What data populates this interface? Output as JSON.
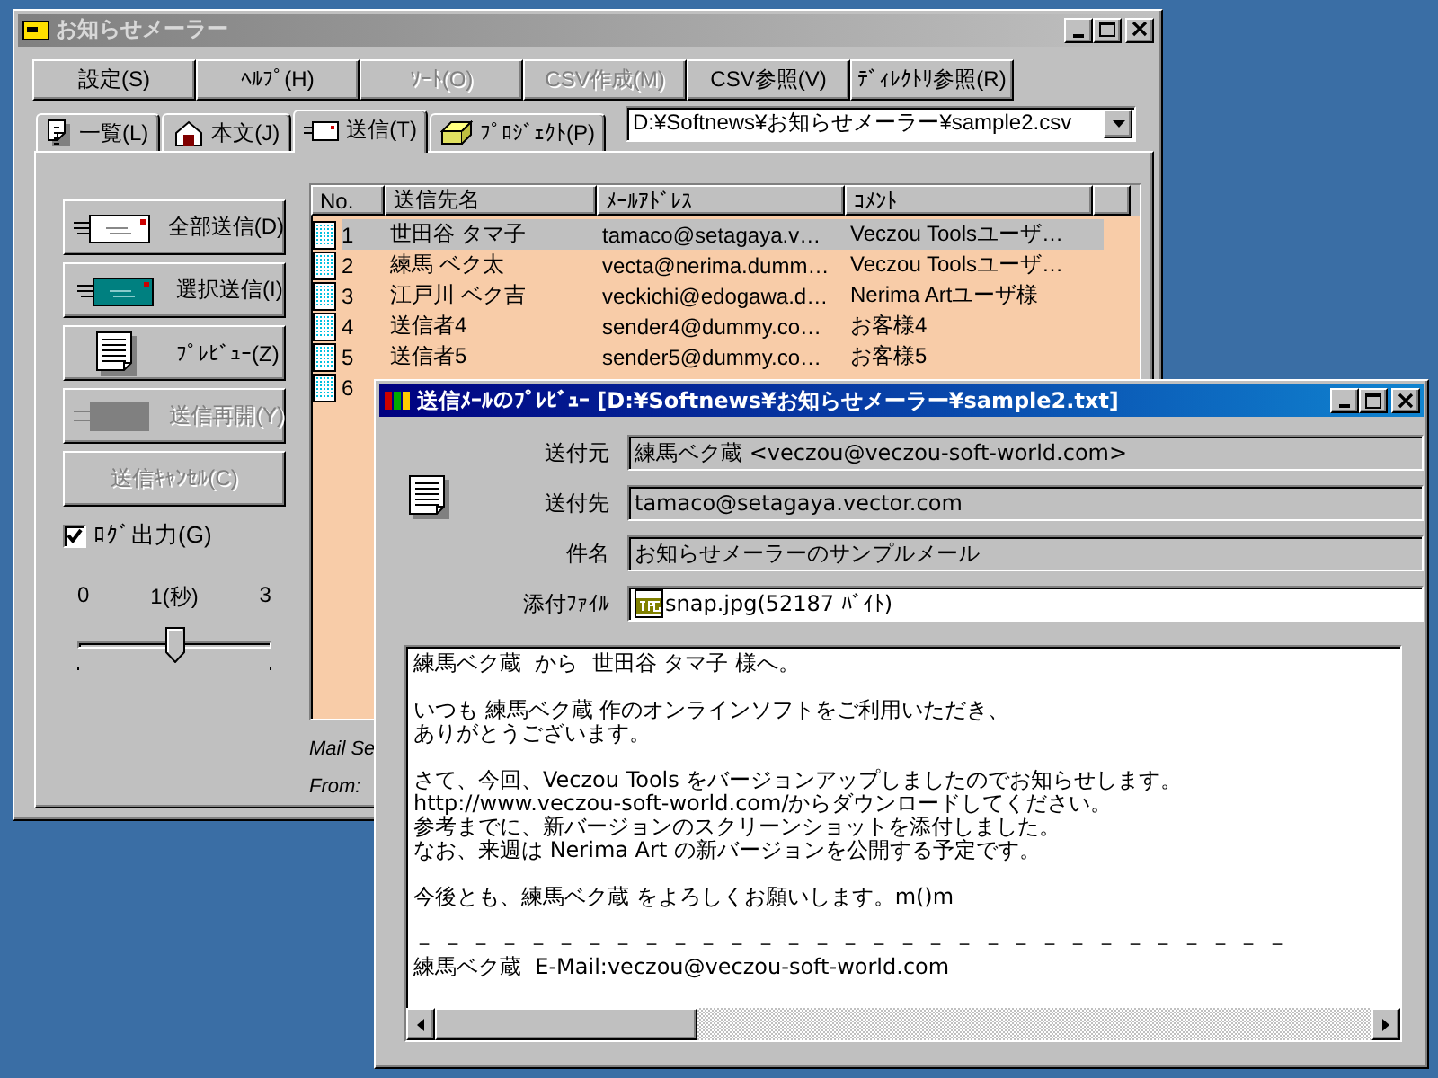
{
  "main_window": {
    "title": "お知らせメーラー",
    "toolbar": [
      {
        "label": "設定(S)",
        "disabled": false
      },
      {
        "label": "ﾍﾙﾌﾟ(H)",
        "disabled": false
      },
      {
        "label": "ｿｰﾄ(O)",
        "disabled": true
      },
      {
        "label": "CSV作成(M)",
        "disabled": true
      },
      {
        "label": "CSV参照(V)",
        "disabled": false
      },
      {
        "label": "ﾃﾞｨﾚｸﾄﾘ参照(R)",
        "disabled": false
      }
    ],
    "tabs": [
      {
        "label": "一覧(L)",
        "kind": "list",
        "selected": false
      },
      {
        "label": "本文(J)",
        "kind": "body",
        "selected": false
      },
      {
        "label": "送信(T)",
        "kind": "send",
        "selected": true
      },
      {
        "label": "ﾌﾟﾛｼﾞｪｸﾄ(P)",
        "kind": "project",
        "selected": false
      }
    ],
    "path_combo": {
      "value": "D:¥Softnews¥お知らせメーラー¥sample2.csv"
    },
    "actions": [
      {
        "label": "全部送信(D)",
        "kind": "all",
        "disabled": false
      },
      {
        "label": "選択送信(I)",
        "kind": "selected",
        "disabled": false
      },
      {
        "label": "ﾌﾟﾚﾋﾞｭｰ(Z)",
        "kind": "preview",
        "disabled": false
      },
      {
        "label": "送信再開(Y)",
        "kind": "resume",
        "disabled": true
      },
      {
        "label": "送信ｷｬﾝｾﾙ(C)",
        "kind": "text",
        "disabled": true
      }
    ],
    "log_output": {
      "label": "ﾛｸﾞ出力(G)",
      "checked": true
    },
    "interval_slider": {
      "min_label": "0",
      "value_label": "1(秒)",
      "max_label": "3",
      "level": 0.5
    },
    "recipient_table": {
      "columns": [
        "No.",
        "送信先名",
        "ﾒｰﾙｱﾄﾞﾚｽ",
        "ｺﾒﾝﾄ"
      ],
      "rows": [
        {
          "no": "1",
          "name": "世田谷 タマ子",
          "email": "tamaco@setagaya.v…",
          "comment": "Veczou Toolsユーザ…",
          "selected": true
        },
        {
          "no": "2",
          "name": "練馬 ベク太",
          "email": "vecta@nerima.dumm…",
          "comment": "Veczou Toolsユーザ…",
          "selected": false
        },
        {
          "no": "3",
          "name": "江戸川 ベク吉",
          "email": "veckichi@edogawa.d…",
          "comment": "Nerima Artユーザ様",
          "selected": false
        },
        {
          "no": "4",
          "name": "送信者4",
          "email": "sender4@dummy.co…",
          "comment": "お客様4",
          "selected": false
        },
        {
          "no": "5",
          "name": "送信者5",
          "email": "sender5@dummy.co…",
          "comment": "お客様5",
          "selected": false
        },
        {
          "no": "6",
          "selected": false
        }
      ]
    },
    "log_lines": [
      "Mail Se",
      "From:"
    ]
  },
  "preview_window": {
    "title": "送信ﾒｰﾙのﾌﾟﾚﾋﾞｭｰ [D:¥Softnews¥お知らせメーラー¥sample2.txt]",
    "fields": [
      {
        "label": "送付元",
        "value": "練馬ベク蔵 <veczou@veczou-soft-world.com>",
        "kind": "readonly"
      },
      {
        "label": "送付先",
        "value": "tamaco@setagaya.vector.com",
        "kind": "readonly"
      },
      {
        "label": "件名",
        "value": "お知らせメーラーのサンプルメール",
        "kind": "readonly"
      },
      {
        "label": "添付ﾌｧｲﾙ",
        "value": "snap.jpg(52187 ﾊﾞｲﾄ)",
        "kind": "attachment"
      }
    ],
    "body_paragraphs": [
      [
        "練馬ベク蔵  から  世田谷 タマ子 様へ。"
      ],
      [
        "いつも 練馬ベク蔵 作のオンラインソフトをご利用いただき、",
        "ありがとうございます。"
      ],
      [
        "さて、今回、Veczou Tools をバージョンアップしましたのでお知らせします。",
        "http://www.veczou-soft-world.com/からダウンロードしてください。",
        "参考までに、新バージョンのスクリーンショットを添付しました。",
        "なお、来週は Nerima Art の新バージョンを公開する予定です。"
      ],
      [
        "今後とも、練馬ベク蔵 をよろしくお願いします。m()m"
      ],
      [
        "－ － － － － － － － － － － － － － － － － － － － － － － － － － － － － － －",
        "練馬ベク蔵  E-Mail:veczou@veczou-soft-world.com"
      ]
    ]
  }
}
